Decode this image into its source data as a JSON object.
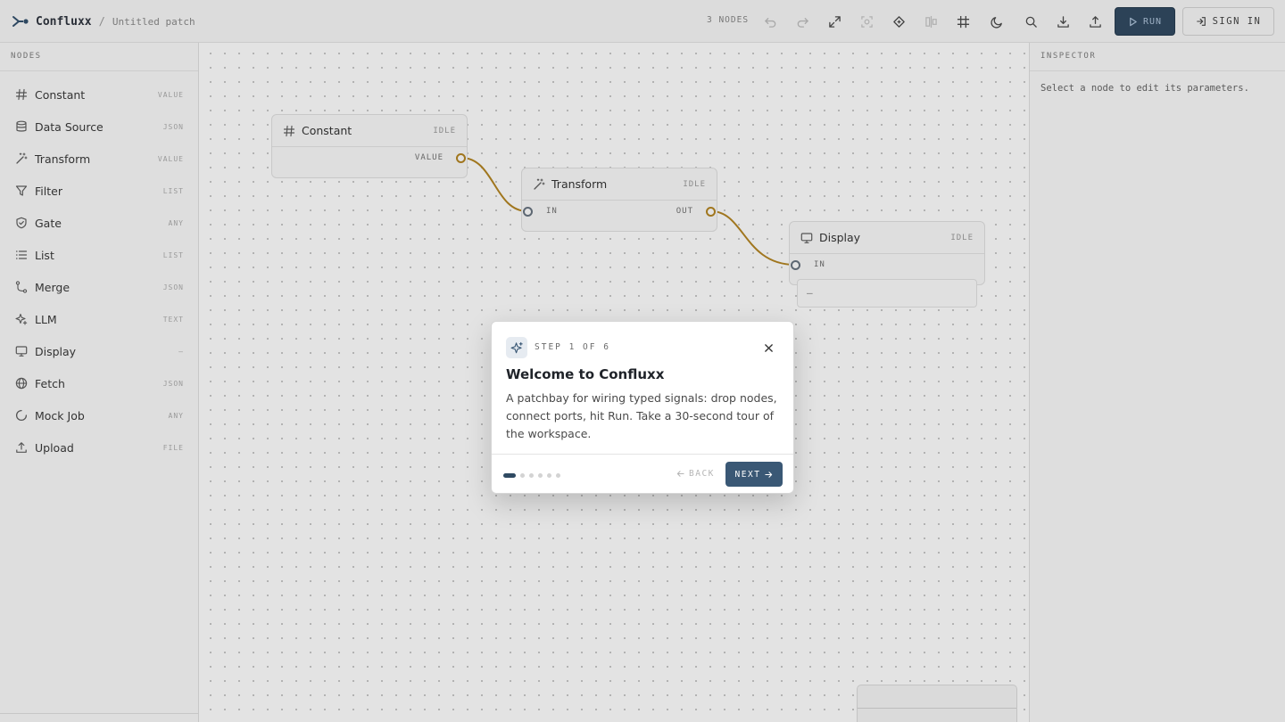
{
  "header": {
    "brand": "Confluxx",
    "separator": "/",
    "file_name": "Untitled patch",
    "node_count": "3 NODES",
    "run_label": "RUN",
    "signin_label": "SIGN IN"
  },
  "sidebar": {
    "title": "NODES",
    "items": [
      {
        "label": "Constant",
        "type": "VALUE",
        "icon": "hash-icon"
      },
      {
        "label": "Data Source",
        "type": "JSON",
        "icon": "database-icon"
      },
      {
        "label": "Transform",
        "type": "VALUE",
        "icon": "wand-icon"
      },
      {
        "label": "Filter",
        "type": "LIST",
        "icon": "filter-icon"
      },
      {
        "label": "Gate",
        "type": "ANY",
        "icon": "shield-check-icon"
      },
      {
        "label": "List",
        "type": "LIST",
        "icon": "list-icon"
      },
      {
        "label": "Merge",
        "type": "JSON",
        "icon": "merge-icon"
      },
      {
        "label": "LLM",
        "type": "TEXT",
        "icon": "sparkles-icon"
      },
      {
        "label": "Display",
        "type": "—",
        "icon": "monitor-icon"
      },
      {
        "label": "Fetch",
        "type": "JSON",
        "icon": "globe-icon"
      },
      {
        "label": "Mock Job",
        "type": "ANY",
        "icon": "loader-icon"
      },
      {
        "label": "Upload",
        "type": "FILE",
        "icon": "upload-icon"
      }
    ]
  },
  "canvas": {
    "nodes": [
      {
        "title": "Constant",
        "status": "IDLE",
        "ports": {
          "out": "VALUE"
        }
      },
      {
        "title": "Transform",
        "status": "IDLE",
        "ports": {
          "in": "IN",
          "out": "OUT"
        }
      },
      {
        "title": "Display",
        "status": "IDLE",
        "ports": {
          "in": "IN"
        },
        "output_value": "—"
      }
    ]
  },
  "inspector": {
    "title": "INSPECTOR",
    "hint": "Select a node to edit its parameters."
  },
  "tour": {
    "step_text": "STEP 1 OF 6",
    "current_step": 1,
    "total_steps": 6,
    "title": "Welcome to Confluxx",
    "body": "A patchbay for wiring typed signals: drop nodes, connect ports, hit Run. Take a 30-second tour of the workspace.",
    "back_label": "BACK",
    "next_label": "NEXT"
  },
  "colors": {
    "accent": "#2c4257",
    "wire": "#a0761e",
    "next_button": "#3a5875"
  }
}
